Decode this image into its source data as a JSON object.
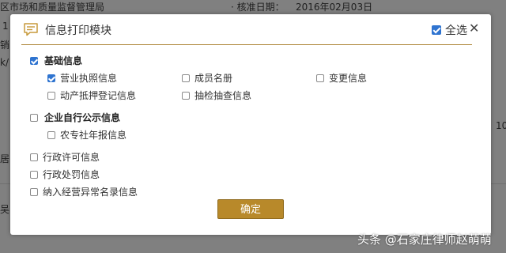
{
  "background": {
    "authority_text": "区市场和质量监督管理局",
    "approval_label": "核准日期：",
    "approval_date": "2016年02月03日",
    "fragment_1": "1",
    "fragment_2": "销",
    "fragment_3": "k/",
    "fragment_4": "居",
    "fragment_5": "吴",
    "fragment_6": "10"
  },
  "modal": {
    "title": "信息打印模块",
    "select_all_label": "全选",
    "select_all_checked": true,
    "groups": [
      {
        "label": "基础信息",
        "checked": true,
        "items": [
          {
            "label": "营业执照信息",
            "checked": true
          },
          {
            "label": "成员名册",
            "checked": false
          },
          {
            "label": "变更信息",
            "checked": false
          },
          {
            "label": "动产抵押登记信息",
            "checked": false
          },
          {
            "label": "抽检抽查信息",
            "checked": false
          }
        ]
      },
      {
        "label": "企业自行公示信息",
        "checked": false,
        "items": [
          {
            "label": "农专社年报信息",
            "checked": false
          }
        ]
      },
      {
        "label": "行政许可信息",
        "checked": false,
        "items": []
      },
      {
        "label": "行政处罚信息",
        "checked": false,
        "items": []
      },
      {
        "label": "纳入经营异常名录信息",
        "checked": false,
        "items": []
      }
    ],
    "confirm_label": "确定"
  },
  "watermark": "头条 @石家庄律师赵萌萌",
  "colors": {
    "accent_gold": "#b8892a",
    "checkbox_blue": "#2f74d0",
    "overlay": "#808080"
  },
  "icons": {
    "header": "message-icon",
    "close": "close-icon"
  }
}
